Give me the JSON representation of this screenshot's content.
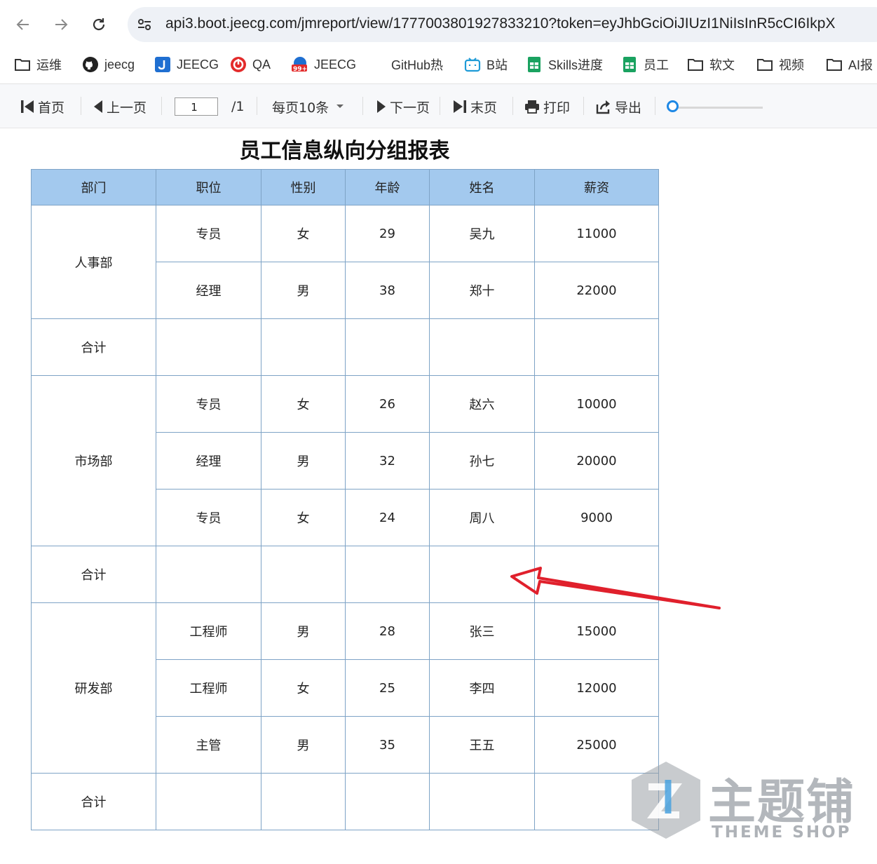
{
  "browser": {
    "url": "api3.boot.jeecg.com/jmreport/view/1777003801927833210?token=eyJhbGciOiJIUzI1NiIsInR5cCI6IkpX",
    "bookmarks": [
      {
        "label": "运维",
        "icon": "folder-icon"
      },
      {
        "label": "jeecg",
        "icon": "github-icon"
      },
      {
        "label": "JEECG",
        "icon": "jeecg-icon"
      },
      {
        "label": "QA",
        "icon": "qa-icon"
      },
      {
        "label": "JEECG",
        "icon": "jeecg-badge-icon"
      },
      {
        "label": "GitHub热",
        "icon": "none"
      },
      {
        "label": "B站",
        "icon": "bilibili-icon"
      },
      {
        "label": "Skills进度",
        "icon": "sheet-icon"
      },
      {
        "label": "员工",
        "icon": "sheet-icon"
      },
      {
        "label": "软文",
        "icon": "folder-icon"
      },
      {
        "label": "视频",
        "icon": "folder-icon"
      },
      {
        "label": "AI报",
        "icon": "folder-icon"
      }
    ]
  },
  "toolbar": {
    "first": "首页",
    "prev": "上一页",
    "page": "1",
    "total": "/1",
    "page_size": "每页10条",
    "next": "下一页",
    "last": "末页",
    "print": "打印",
    "export": "导出",
    "zoom": 0
  },
  "report": {
    "title": "员工信息纵向分组报表",
    "headers": [
      "部门",
      "职位",
      "性别",
      "年龄",
      "姓名",
      "薪资"
    ],
    "groups": [
      {
        "dept": "人事部",
        "rows": [
          [
            "专员",
            "女",
            "29",
            "吴九",
            "11000"
          ],
          [
            "经理",
            "男",
            "38",
            "郑十",
            "22000"
          ]
        ],
        "total_label": "合计"
      },
      {
        "dept": "市场部",
        "rows": [
          [
            "专员",
            "女",
            "26",
            "赵六",
            "10000"
          ],
          [
            "经理",
            "男",
            "32",
            "孙七",
            "20000"
          ],
          [
            "专员",
            "女",
            "24",
            "周八",
            "9000"
          ]
        ],
        "total_label": "合计"
      },
      {
        "dept": "研发部",
        "rows": [
          [
            "工程师",
            "男",
            "28",
            "张三",
            "15000"
          ],
          [
            "工程师",
            "女",
            "25",
            "李四",
            "12000"
          ],
          [
            "主管",
            "男",
            "35",
            "王五",
            "25000"
          ]
        ],
        "total_label": "合计"
      }
    ]
  },
  "colors": {
    "header_bg": "#a3c9ee",
    "border": "#7ea3c6",
    "arrow": "#e0202c",
    "slider": "#1e88e5"
  },
  "watermark": {
    "cn": "主题铺",
    "en": "THEME SHOP"
  }
}
